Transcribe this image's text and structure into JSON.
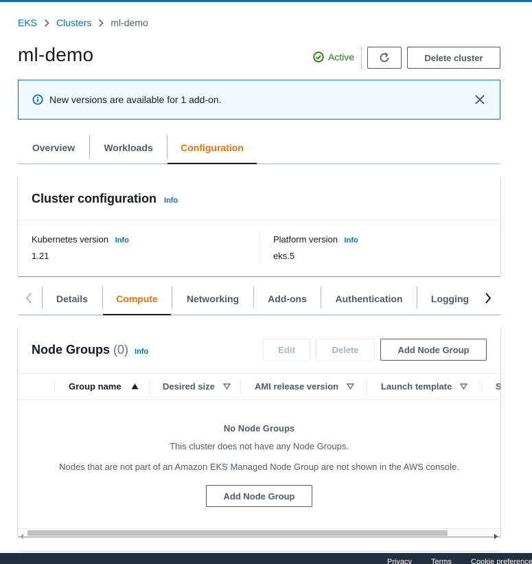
{
  "breadcrumb": {
    "items": [
      {
        "label": "EKS"
      },
      {
        "label": "Clusters"
      },
      {
        "label": "ml-demo"
      }
    ]
  },
  "header": {
    "title": "ml-demo",
    "status": "Active",
    "delete_label": "Delete cluster"
  },
  "flash": {
    "message": "New versions are available for 1 add-on."
  },
  "main_tabs": [
    {
      "label": "Overview"
    },
    {
      "label": "Workloads"
    },
    {
      "label": "Configuration"
    }
  ],
  "cluster_config": {
    "title": "Cluster configuration",
    "info": "Info",
    "kubernetes_label": "Kubernetes version",
    "kubernetes_value": "1.21",
    "platform_label": "Platform version",
    "platform_value": "eks.5"
  },
  "sub_tabs": [
    {
      "label": "Details"
    },
    {
      "label": "Compute"
    },
    {
      "label": "Networking"
    },
    {
      "label": "Add-ons"
    },
    {
      "label": "Authentication"
    },
    {
      "label": "Logging"
    }
  ],
  "node_groups": {
    "title": "Node Groups",
    "count": "(0)",
    "info": "Info",
    "edit_label": "Edit",
    "delete_label": "Delete",
    "add_label": "Add Node Group",
    "columns": [
      "Group name",
      "Desired size",
      "AMI release version",
      "Launch template",
      "S"
    ],
    "empty_title": "No Node Groups",
    "empty_desc": "This cluster does not have any Node Groups.",
    "empty_note": "Nodes that are not part of an Amazon EKS Managed Node Group are not shown in the AWS console.",
    "empty_add_label": "Add Node Group"
  },
  "footer": {
    "links": [
      "Privacy",
      "Terms",
      "Cookie preferences"
    ]
  },
  "colors": {
    "link": "#0073bb",
    "active_tab": "#ec7211",
    "status_green": "#1d8102",
    "flash_bg": "#f1faff",
    "footer_bg": "#232f3e"
  },
  "icons": {
    "status": "check-circle-icon",
    "refresh": "refresh-icon",
    "flash": "info-circle-icon",
    "dismiss": "close-icon",
    "sort_asc": "caret-up-icon",
    "sort_desc": "caret-down-outline-icon"
  }
}
